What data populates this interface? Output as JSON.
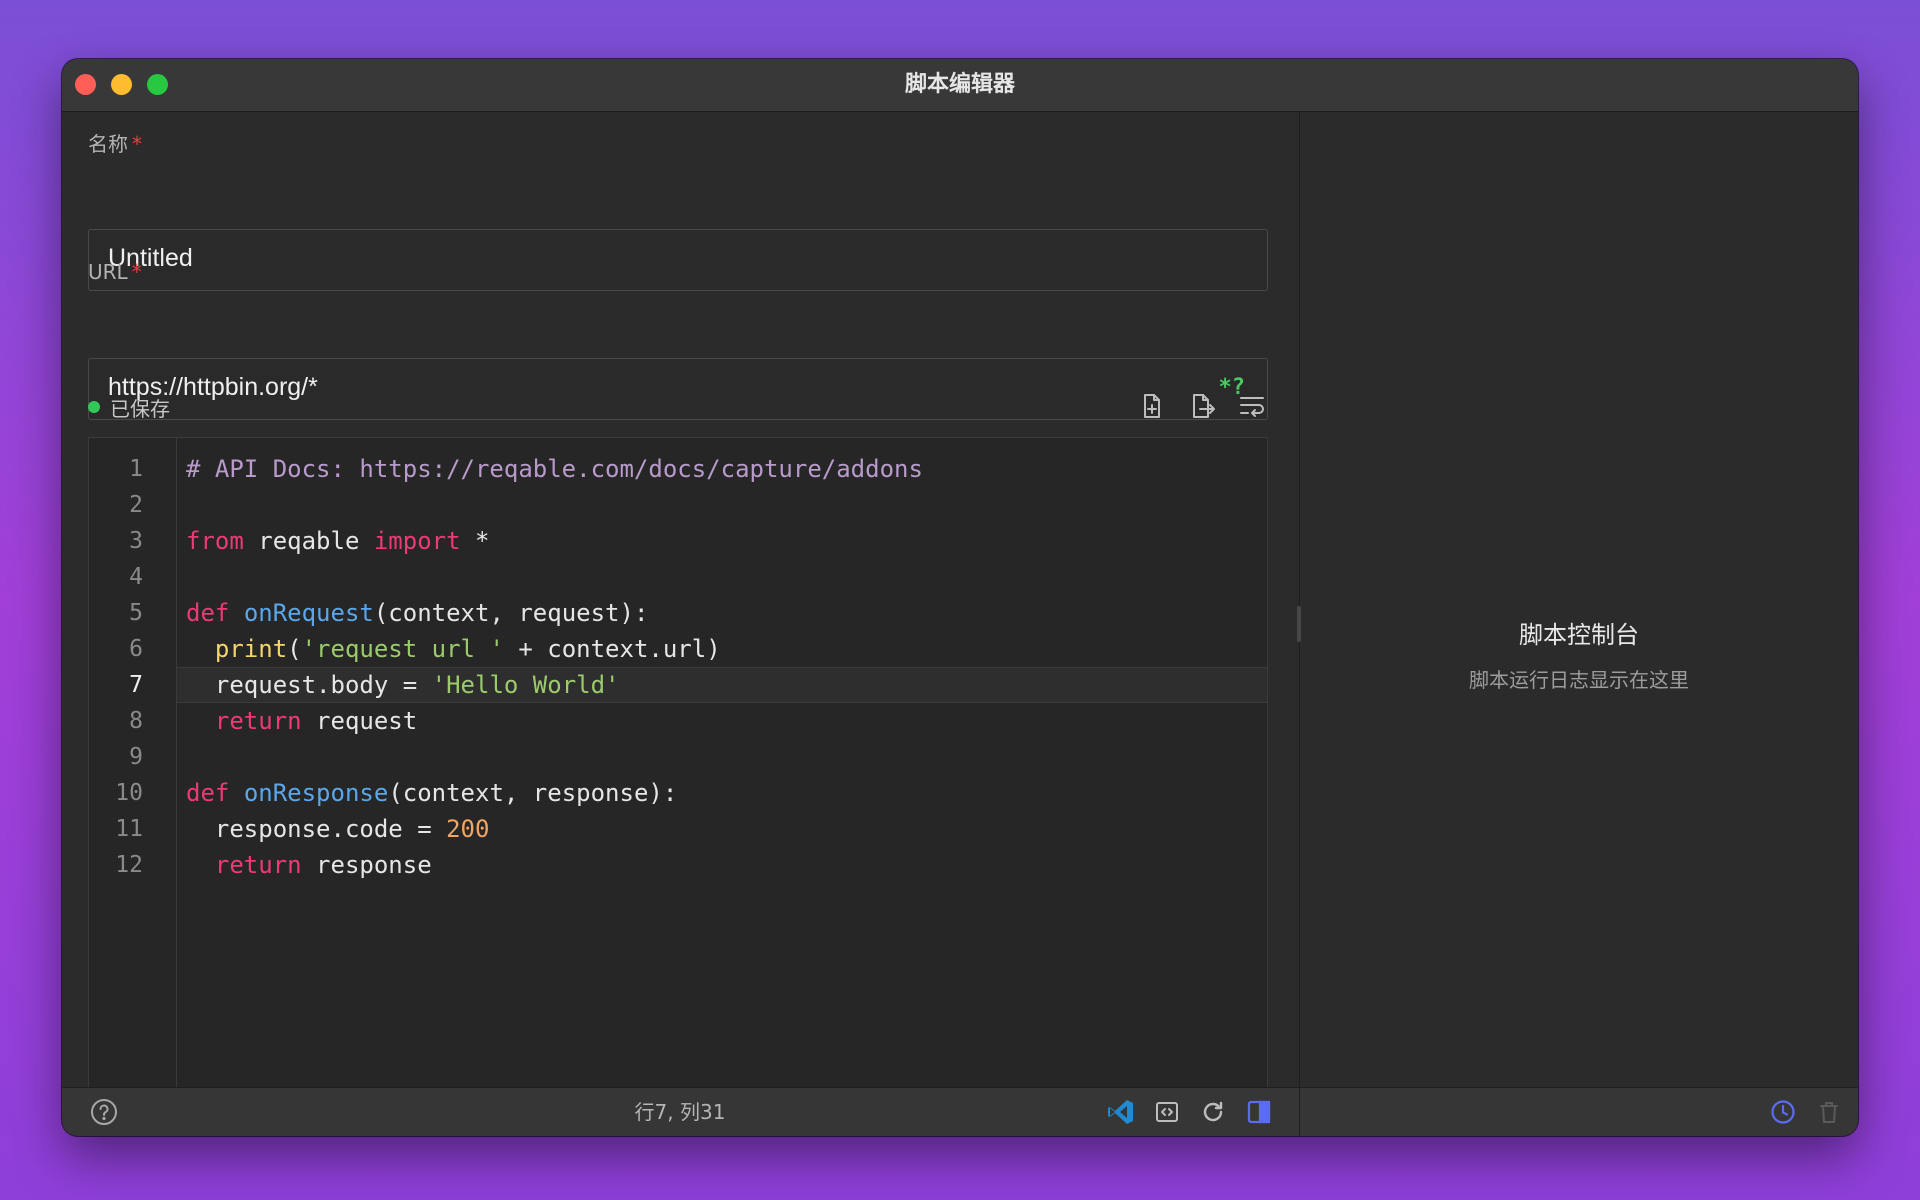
{
  "window": {
    "title": "脚本编辑器"
  },
  "form": {
    "name_label": "名称",
    "name_required": "*",
    "name_value": "Untitled",
    "url_label": "URL",
    "url_required": "*",
    "url_value": "https://httpbin.org/*",
    "regex_toggle": "*?"
  },
  "editor": {
    "status": "已保存",
    "status_color": "#32c759",
    "tools": [
      "file-import-icon",
      "file-export-icon",
      "wrap-lines-icon"
    ],
    "active_line": 7,
    "lines": [
      {
        "num": "1"
      },
      {
        "num": "2"
      },
      {
        "num": "3"
      },
      {
        "num": "4"
      },
      {
        "num": "5"
      },
      {
        "num": "6"
      },
      {
        "num": "7"
      },
      {
        "num": "8"
      },
      {
        "num": "9"
      },
      {
        "num": "10"
      },
      {
        "num": "11"
      },
      {
        "num": "12"
      }
    ],
    "tokens": {
      "l1": "# API Docs: https://reqable.com/docs/capture/addons",
      "l3_kw1": "from",
      "l3_mod": " reqable ",
      "l3_kw2": "import",
      "l3_rest": " *",
      "l5_kw": "def",
      "l5_fn": "onRequest",
      "l5_rest": "(context, request):",
      "l6_fn": "print",
      "l6_p1": "(",
      "l6_str": "'request url '",
      "l6_rest": " + context.url)",
      "l7_rest": "request.body = ",
      "l7_str": "'Hello World'",
      "l8_kw": "return",
      "l8_rest": " request",
      "l10_kw": "def",
      "l10_fn": "onResponse",
      "l10_rest": "(context, response):",
      "l11_rest": "response.code = ",
      "l11_num": "200",
      "l12_kw": "return",
      "l12_rest": " response"
    }
  },
  "console": {
    "title": "脚本控制台",
    "subtitle": "脚本运行日志显示在这里"
  },
  "statusbar": {
    "cursor": "行7, 列31",
    "icons": [
      "help-icon",
      "vscode-icon",
      "code-format-icon",
      "reload-icon",
      "sidebar-toggle-icon",
      "history-icon",
      "trash-icon"
    ]
  },
  "colors": {
    "accent": "#5b6cf0",
    "keyword": "#ee3a74",
    "function": "#5aa7ec",
    "string": "#9bcb6b",
    "number": "#f2a461",
    "comment": "#b89acb",
    "builtin": "#f4d66b"
  }
}
